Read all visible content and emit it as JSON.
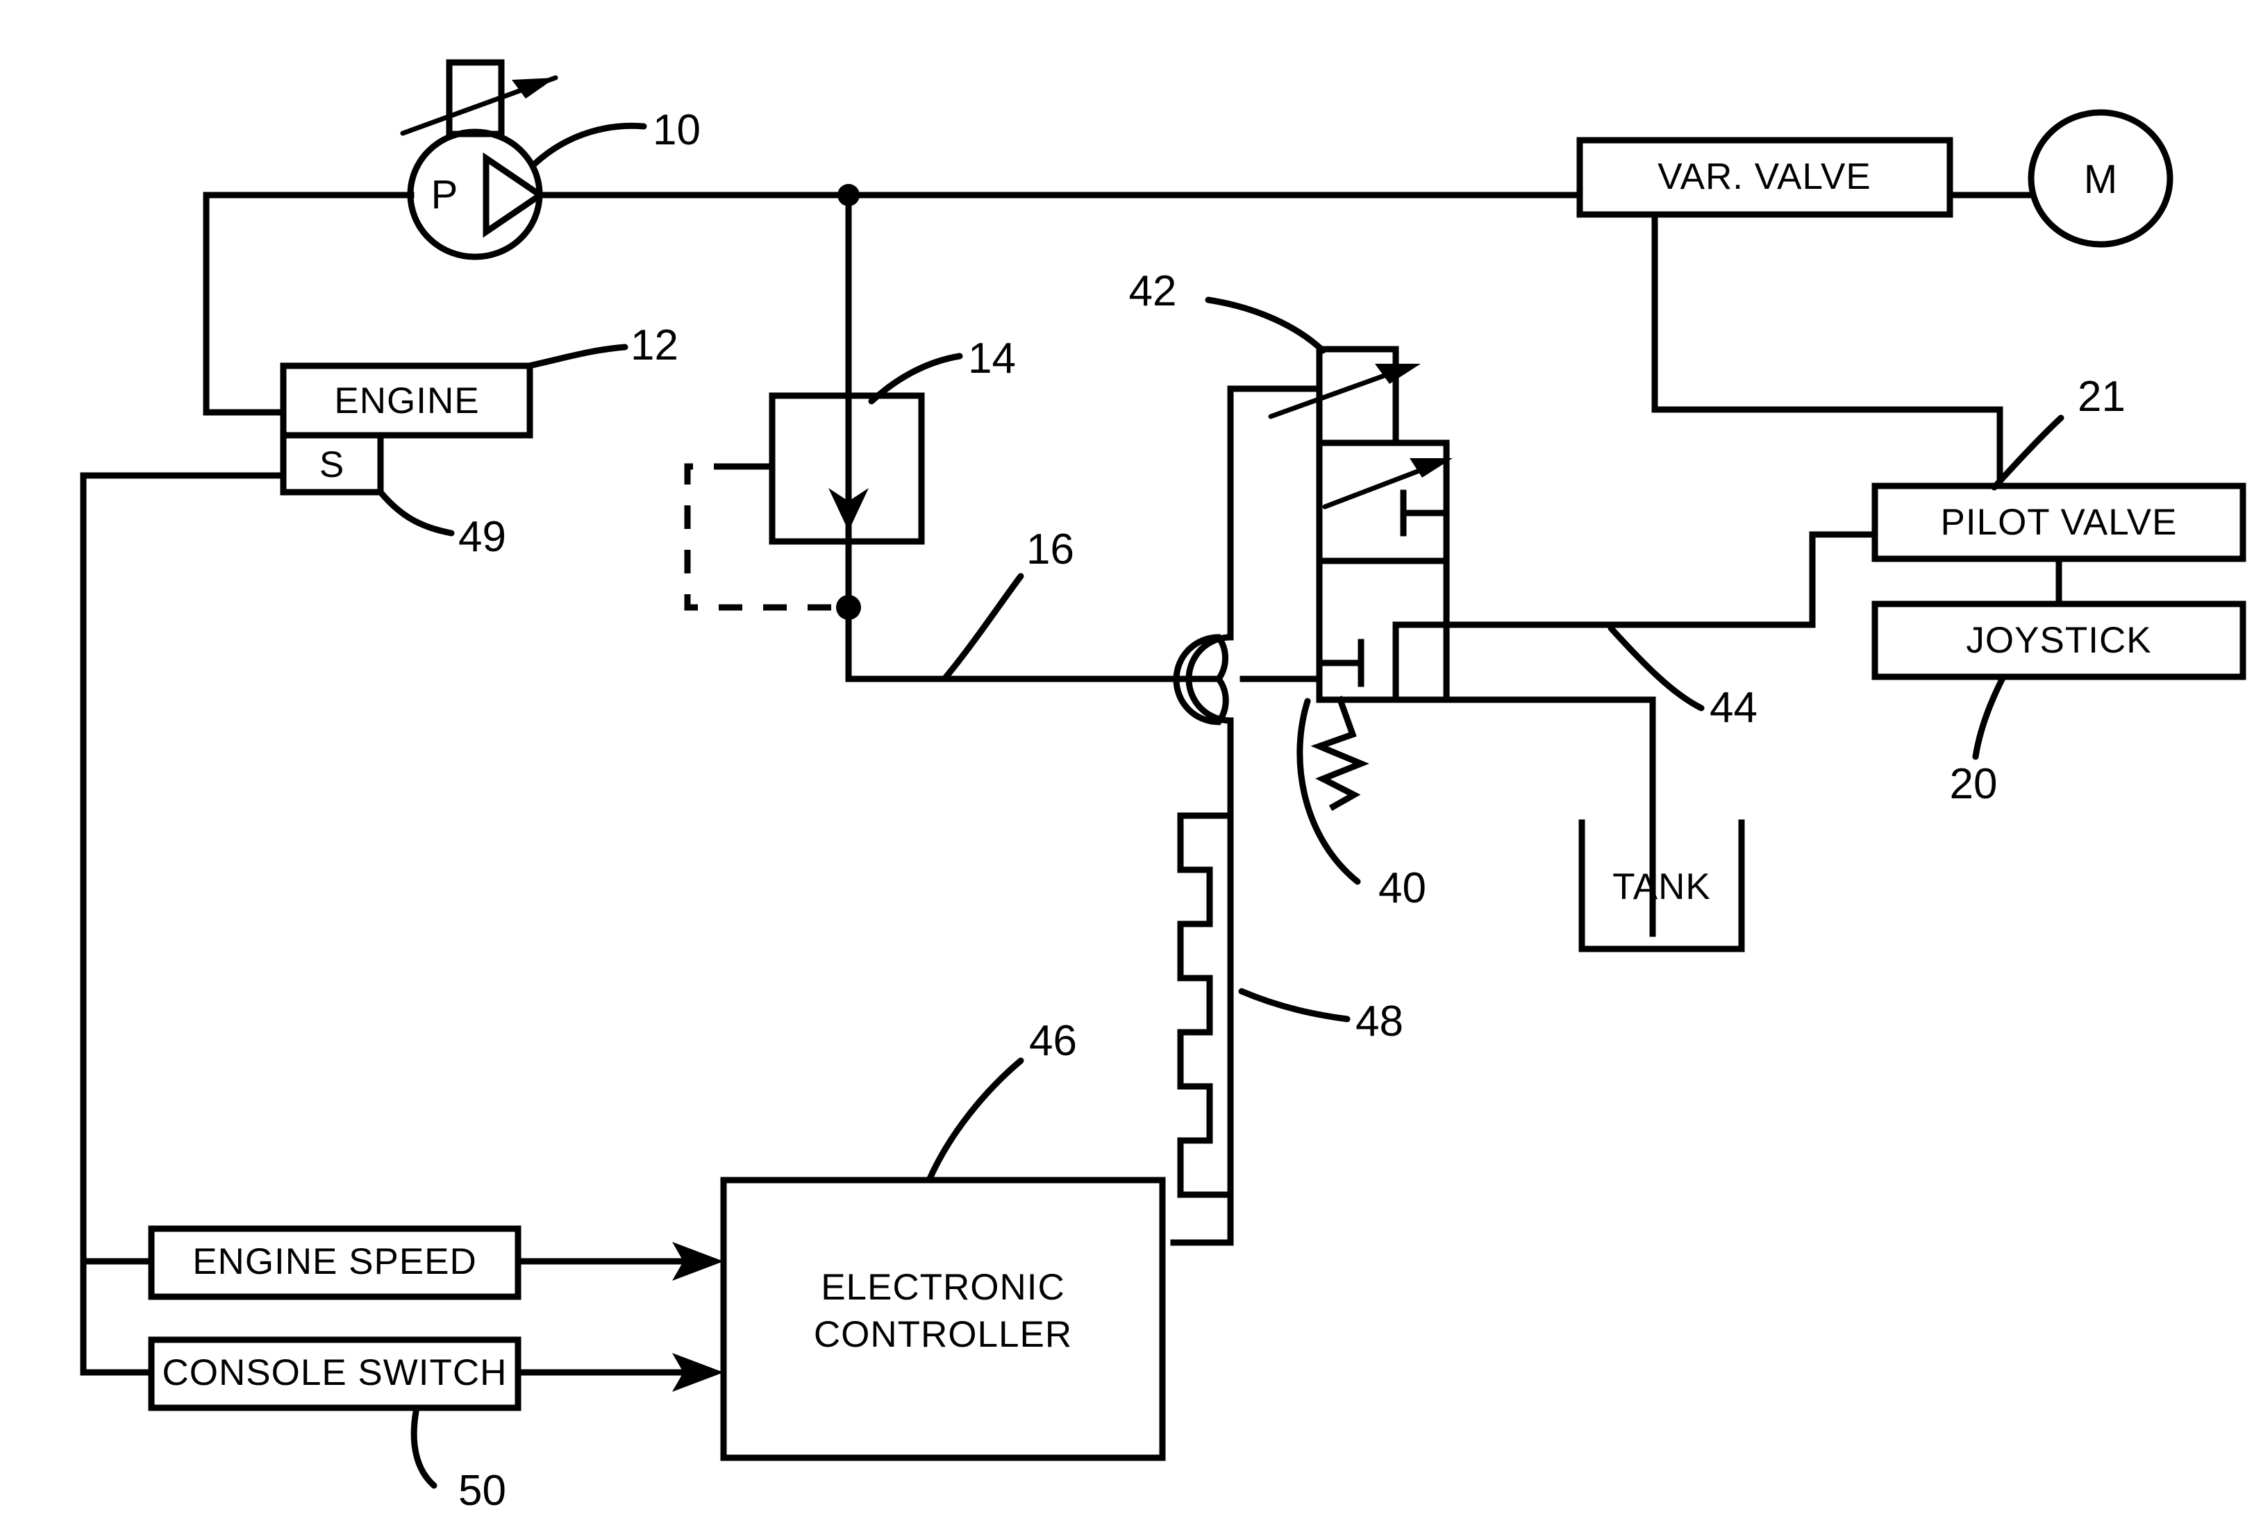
{
  "figure": {
    "kind": "hydraulic-schematic",
    "background": "#ffffff",
    "ink": "#000000"
  },
  "blocks": {
    "pump": {
      "label": "P",
      "ref": "10",
      "type": "variable-displacement-pump"
    },
    "engine": {
      "label": "ENGINE",
      "ref": "12"
    },
    "speed_sensor": {
      "label": "S",
      "ref": "49"
    },
    "relief_valve": {
      "ref": "14",
      "type": "pressure-relief-valve"
    },
    "supply_line": {
      "ref": "16"
    },
    "var_valve": {
      "label": "VAR. VALVE"
    },
    "motor": {
      "label": "M",
      "type": "hydraulic-motor"
    },
    "pilot_valve": {
      "label": "PILOT VALVE",
      "ref": "21"
    },
    "joystick": {
      "label": "JOYSTICK",
      "ref": "20"
    },
    "tank": {
      "label": "TANK"
    },
    "control_valve": {
      "spring_ref": "40",
      "variable_ref": "42",
      "pilot_line_ref": "44",
      "solenoid_ref": "48"
    },
    "controller": {
      "label_line1": "ELECTRONIC",
      "label_line2": "CONTROLLER",
      "ref": "46"
    },
    "engine_speed_input": {
      "label": "ENGINE SPEED"
    },
    "console_switch_input": {
      "label": "CONSOLE SWITCH",
      "ref": "50"
    }
  },
  "callouts": [
    {
      "id": "c10",
      "text": "10"
    },
    {
      "id": "c12",
      "text": "12"
    },
    {
      "id": "c14",
      "text": "14"
    },
    {
      "id": "c16",
      "text": "16"
    },
    {
      "id": "c20",
      "text": "20"
    },
    {
      "id": "c21",
      "text": "21"
    },
    {
      "id": "c40",
      "text": "40"
    },
    {
      "id": "c42",
      "text": "42"
    },
    {
      "id": "c44",
      "text": "44"
    },
    {
      "id": "c46",
      "text": "46"
    },
    {
      "id": "c48",
      "text": "48"
    },
    {
      "id": "c49",
      "text": "49"
    },
    {
      "id": "c50",
      "text": "50"
    }
  ]
}
